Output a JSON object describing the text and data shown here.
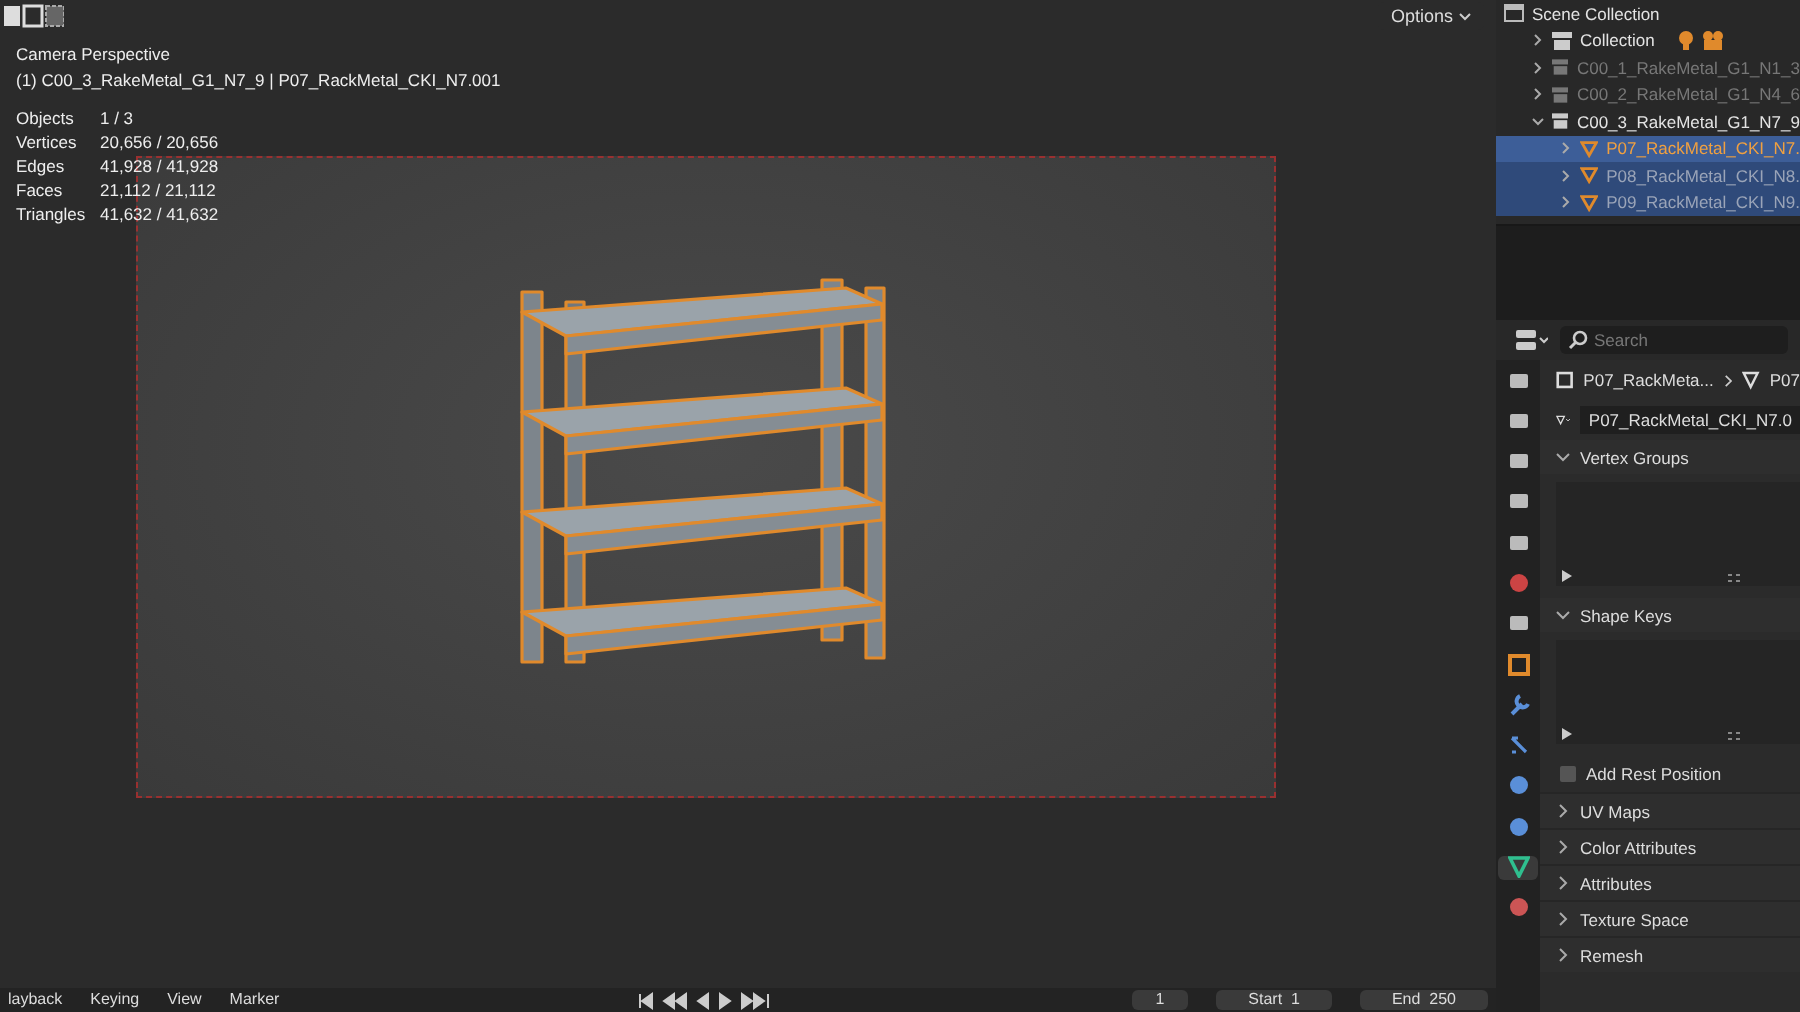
{
  "viewport": {
    "options_label": "Options",
    "view_name": "Camera Perspective",
    "object_path": "(1) C00_3_RakeMetal_G1_N7_9 | P07_RackMetal_CKI_N7.001",
    "stats": [
      {
        "label": "Objects",
        "value": "1 / 3"
      },
      {
        "label": "Vertices",
        "value": "20,656 / 20,656"
      },
      {
        "label": "Edges",
        "value": "41,928 / 41,928"
      },
      {
        "label": "Faces",
        "value": "21,112 / 21,112"
      },
      {
        "label": "Triangles",
        "value": "41,632 / 41,632"
      }
    ]
  },
  "outliner": {
    "items": [
      {
        "label": "Scene Collection",
        "kind": "scene",
        "children": [
          {
            "label": "Collection",
            "kind": "collection",
            "expanded": false,
            "dimmed": false,
            "selected": false,
            "active": false
          },
          {
            "label": "C00_1_RakeMetal_G1_N1_3",
            "kind": "collection",
            "expanded": false,
            "dimmed": true,
            "selected": false,
            "active": false
          },
          {
            "label": "C00_2_RakeMetal_G1_N4_6",
            "kind": "collection",
            "expanded": false,
            "dimmed": true,
            "selected": false,
            "active": false
          },
          {
            "label": "C00_3_RakeMetal_G1_N7_9",
            "kind": "collection",
            "expanded": true,
            "dimmed": false,
            "selected": false,
            "active": false,
            "children": [
              {
                "label": "P07_RackMetal_CKI_N7.",
                "kind": "mesh",
                "expanded": false,
                "selected": true,
                "active": true
              },
              {
                "label": "P08_RackMetal_CKI_N8.",
                "kind": "mesh",
                "expanded": false,
                "selected": true,
                "active": false
              },
              {
                "label": "P09_RackMetal_CKI_N9.",
                "kind": "mesh",
                "expanded": false,
                "selected": true,
                "active": false
              }
            ]
          }
        ]
      }
    ]
  },
  "properties": {
    "search": {
      "placeholder": "Search"
    },
    "breadcrumb": [
      "P07_RackMeta...",
      "P07"
    ],
    "mesh_name": "P07_RackMetal_CKI_N7.0",
    "tabs": [
      {
        "kind": "tool",
        "selected": false
      },
      {
        "kind": "render",
        "selected": false
      },
      {
        "kind": "output",
        "selected": false
      },
      {
        "kind": "view",
        "selected": false
      },
      {
        "kind": "scene",
        "selected": false
      },
      {
        "kind": "world",
        "selected": false
      },
      {
        "kind": "collection",
        "selected": false
      },
      {
        "kind": "object",
        "selected": false
      },
      {
        "kind": "modifier",
        "selected": false
      },
      {
        "kind": "particles",
        "selected": false
      },
      {
        "kind": "physics",
        "selected": false
      },
      {
        "kind": "constraints",
        "selected": false
      },
      {
        "kind": "data",
        "selected": true
      },
      {
        "kind": "material",
        "selected": false
      }
    ],
    "panels": [
      {
        "kind": "list",
        "title": "Vertex Groups",
        "expanded": true
      },
      {
        "kind": "list",
        "title": "Shape Keys",
        "expanded": true
      },
      {
        "kind": "checkbox",
        "title": "Add Rest Position",
        "checked": false
      },
      {
        "kind": "panel",
        "title": "UV Maps",
        "expanded": false
      },
      {
        "kind": "panel",
        "title": "Color Attributes",
        "expanded": false
      },
      {
        "kind": "panel",
        "title": "Attributes",
        "expanded": false
      },
      {
        "kind": "panel",
        "title": "Texture Space",
        "expanded": false
      },
      {
        "kind": "panel",
        "title": "Remesh",
        "expanded": false
      }
    ]
  },
  "timeline": {
    "menus": [
      "layback",
      "Keying",
      "View",
      "Marker"
    ],
    "current_frame": "1",
    "start_label": "Start",
    "start": "1",
    "end_label": "End",
    "end": "250"
  }
}
